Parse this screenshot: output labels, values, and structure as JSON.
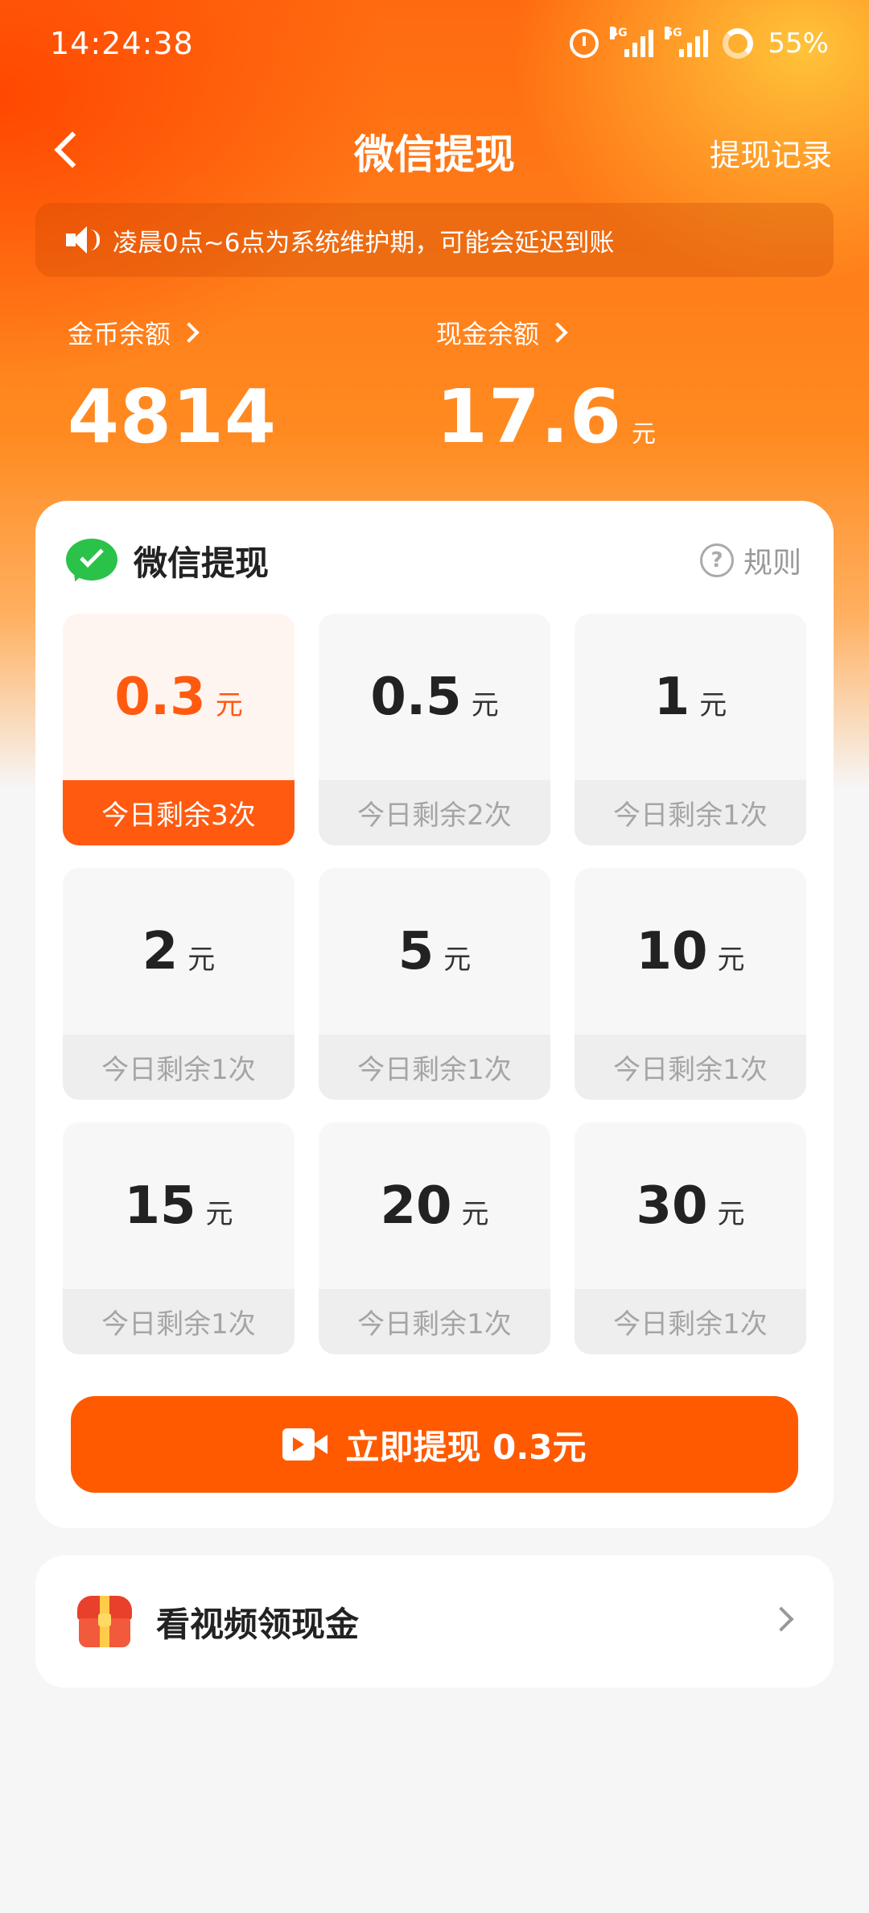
{
  "status_bar": {
    "time": "14:24:38",
    "net_4g": "4G",
    "net_5g": "5G",
    "battery": "55%"
  },
  "header": {
    "title": "微信提现",
    "history_link": "提现记录"
  },
  "notice": {
    "text": "凌晨0点~6点为系统维护期，可能会延迟到账"
  },
  "balances": {
    "coins": {
      "label": "金币余额",
      "value": "4814"
    },
    "cash": {
      "label": "现金余额",
      "value": "17.6",
      "unit": "元"
    }
  },
  "withdraw_card": {
    "title": "微信提现",
    "rules_label": "规则",
    "options": [
      {
        "amount": "0.3",
        "unit": "元",
        "remaining": "今日剩余3次",
        "selected": true
      },
      {
        "amount": "0.5",
        "unit": "元",
        "remaining": "今日剩余2次",
        "selected": false
      },
      {
        "amount": "1",
        "unit": "元",
        "remaining": "今日剩余1次",
        "selected": false
      },
      {
        "amount": "2",
        "unit": "元",
        "remaining": "今日剩余1次",
        "selected": false
      },
      {
        "amount": "5",
        "unit": "元",
        "remaining": "今日剩余1次",
        "selected": false
      },
      {
        "amount": "10",
        "unit": "元",
        "remaining": "今日剩余1次",
        "selected": false
      },
      {
        "amount": "15",
        "unit": "元",
        "remaining": "今日剩余1次",
        "selected": false
      },
      {
        "amount": "20",
        "unit": "元",
        "remaining": "今日剩余1次",
        "selected": false
      },
      {
        "amount": "30",
        "unit": "元",
        "remaining": "今日剩余1次",
        "selected": false
      }
    ],
    "button_label": "立即提现 0.3元"
  },
  "reward_row": {
    "label": "看视频领现金"
  },
  "colors": {
    "accent": "#ff5a00",
    "wechat_green": "#2bc24a"
  }
}
